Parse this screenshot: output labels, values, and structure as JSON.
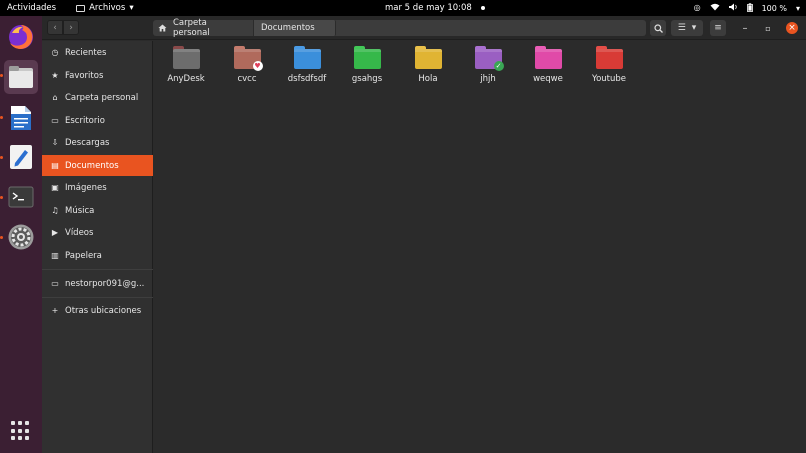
{
  "topbar": {
    "activities": "Actividades",
    "app_menu": "Archivos",
    "clock": "mar  5 de may  10:08",
    "battery": "100 %"
  },
  "dock": {
    "items": [
      {
        "name": "firefox",
        "icon": "firefox-icon"
      },
      {
        "name": "files",
        "icon": "files-icon"
      },
      {
        "name": "writer",
        "icon": "writer-icon"
      },
      {
        "name": "text-editor",
        "icon": "text-editor-icon"
      },
      {
        "name": "terminal",
        "icon": "terminal-icon"
      },
      {
        "name": "settings",
        "icon": "settings-icon"
      }
    ],
    "show_apps": "apps-grid-icon"
  },
  "pathbar": {
    "home": "Carpeta personal",
    "current": "Documentos"
  },
  "sidebar": {
    "items": [
      {
        "label": "Recientes",
        "icon": "clock-icon",
        "glyph": "◷"
      },
      {
        "label": "Favoritos",
        "icon": "star-icon",
        "glyph": "★"
      },
      {
        "label": "Carpeta personal",
        "icon": "home-icon",
        "glyph": "⌂"
      },
      {
        "label": "Escritorio",
        "icon": "desktop-icon",
        "glyph": "▭"
      },
      {
        "label": "Descargas",
        "icon": "download-icon",
        "glyph": "⇩"
      },
      {
        "label": "Documentos",
        "icon": "document-icon",
        "glyph": "▤"
      },
      {
        "label": "Imágenes",
        "icon": "image-icon",
        "glyph": "▣"
      },
      {
        "label": "Música",
        "icon": "music-icon",
        "glyph": "♫"
      },
      {
        "label": "Vídeos",
        "icon": "video-icon",
        "glyph": "▶"
      },
      {
        "label": "Papelera",
        "icon": "trash-icon",
        "glyph": "🗑"
      },
      {
        "label": "nestorpor091@g...",
        "icon": "account-icon",
        "glyph": "▭"
      },
      {
        "label": "Otras ubicaciones",
        "icon": "plus-icon",
        "glyph": "+"
      }
    ],
    "active_index": 5
  },
  "files": [
    {
      "name": "AnyDesk",
      "color": "#6d6d6d",
      "tab_color": "#8a4a4a",
      "emblem": ""
    },
    {
      "name": "cvcc",
      "color": "#b06a5c",
      "tab_color": "#c57b6c",
      "emblem": "heart"
    },
    {
      "name": "dsfsdfsdf",
      "color": "#3b8fdb",
      "tab_color": "#4a9be6",
      "emblem": ""
    },
    {
      "name": "gsahgs",
      "color": "#36b84a",
      "tab_color": "#41c957",
      "emblem": ""
    },
    {
      "name": "Hola",
      "color": "#e0b433",
      "tab_color": "#ebc14a",
      "emblem": ""
    },
    {
      "name": "jhjh",
      "color": "#9a5fc2",
      "tab_color": "#a96fd1",
      "emblem": "check"
    },
    {
      "name": "weqwe",
      "color": "#e04aa8",
      "tab_color": "#ec5cb7",
      "emblem": ""
    },
    {
      "name": "Youtube",
      "color": "#d83b36",
      "tab_color": "#e54d47",
      "emblem": ""
    }
  ],
  "colors": {
    "accent": "#e95420",
    "dock_bg": "#3b1f33",
    "window_bg": "#2b2b2b"
  }
}
